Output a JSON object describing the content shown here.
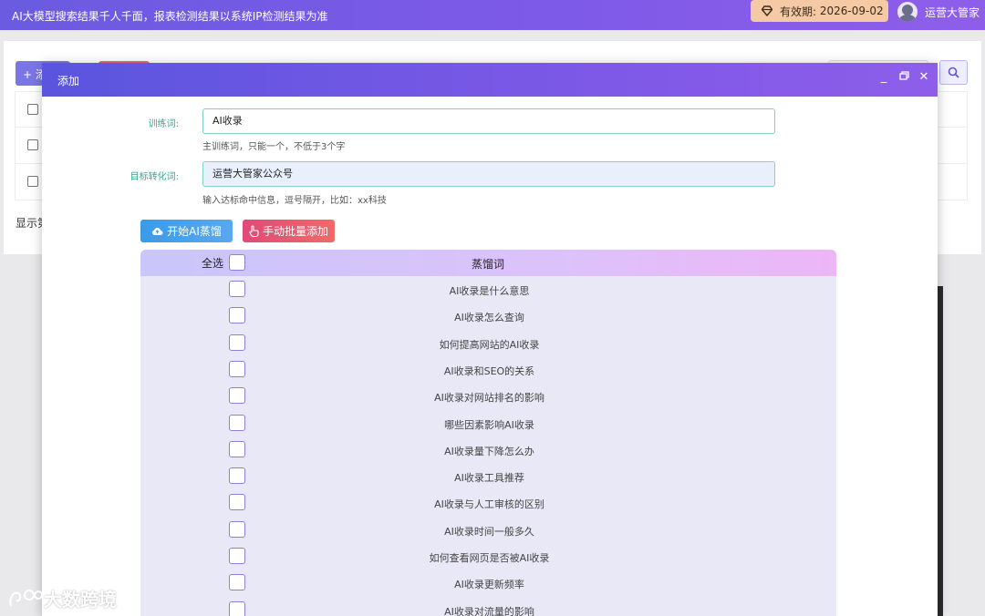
{
  "topbar": {
    "notice": "AI大模型搜索结果千人千面，报表检测结果以系统IP检测结果为准",
    "validity_label": "有效期:",
    "validity_date": "2026-09-02",
    "username": "运营大管家"
  },
  "background": {
    "add_label": "+ 添",
    "show_label": "显示第"
  },
  "modal": {
    "title": "添加",
    "form": {
      "train_label": "训练词:",
      "train_value": "AI收录",
      "train_hint": "主训练词，只能一个，不低于3个字",
      "target_label": "目标转化词:",
      "target_value": "运营大管家公众号",
      "target_hint": "输入达标命中信息，逗号隔开，比如：xx科技"
    },
    "buttons": {
      "ai_distill": "开始AI蒸馏",
      "manual_add": "手动批量添加"
    },
    "table": {
      "select_all": "全选",
      "column_title": "蒸馏词",
      "rows": [
        "AI收录是什么意思",
        "AI收录怎么查询",
        "如何提高网站的AI收录",
        "AI收录和SEO的关系",
        "AI收录对网站排名的影响",
        "哪些因素影响AI收录",
        "AI收录量下降怎么办",
        "AI收录工具推荐",
        "AI收录与人工审核的区别",
        "AI收录时间一般多久",
        "如何查看网页是否被AI收录",
        "AI收录更新频率",
        "AI收录对流量的影响"
      ]
    }
  },
  "watermark": "大数跨境",
  "colors": {
    "topbar_start": "#6a5be0",
    "topbar_end": "#8e5ee9",
    "validity_bg": "#f4c9a3",
    "label_green": "#2bab8e",
    "btn_blue": "#3a9be8",
    "btn_red": "#e04a78",
    "table_bg": "#e9e8f6"
  }
}
